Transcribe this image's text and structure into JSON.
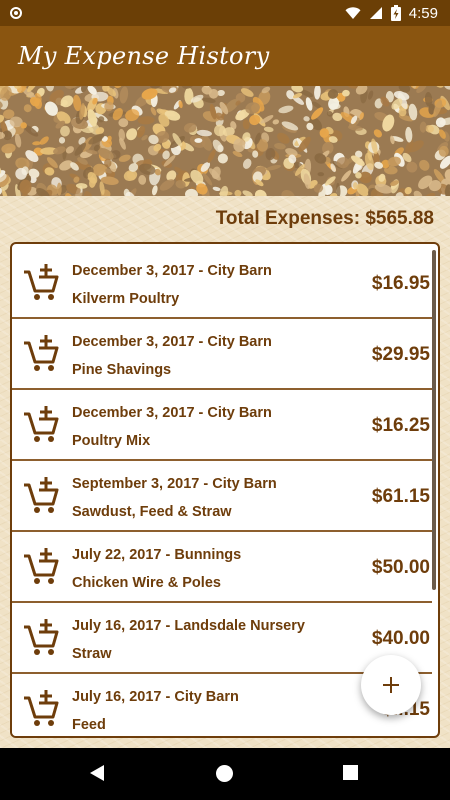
{
  "status_bar": {
    "time": "4:59",
    "icons": [
      "notification-circle-icon",
      "wifi-icon",
      "signal-icon",
      "battery-charging-icon"
    ]
  },
  "app_bar": {
    "title": "My Expense History"
  },
  "summary": {
    "total": "Total Expenses: $565.88"
  },
  "expenses": [
    {
      "title": "December 3, 2017 - City Barn",
      "item": "Kilverm Poultry",
      "amount": "$16.95"
    },
    {
      "title": "December 3, 2017 - City Barn",
      "item": "Pine Shavings",
      "amount": "$29.95"
    },
    {
      "title": "December 3, 2017 - City Barn",
      "item": "Poultry Mix",
      "amount": "$16.25"
    },
    {
      "title": "September 3, 2017 - City Barn",
      "item": "Sawdust, Feed & Straw",
      "amount": "$61.15"
    },
    {
      "title": "July 22, 2017 - Bunnings",
      "item": "Chicken Wire & Poles",
      "amount": "$50.00"
    },
    {
      "title": "July 16, 2017 - Landsdale Nursery",
      "item": "Straw",
      "amount": "$40.00"
    },
    {
      "title": "July 16, 2017 - City Barn",
      "item": "Feed",
      "amount": "$...15"
    }
  ],
  "fab": {
    "icon": "plus-icon"
  },
  "colors": {
    "status_bar": "#6b3f06",
    "app_bar": "#8a5510",
    "accent": "#6e3d0b",
    "background": "#f0e2c6"
  }
}
